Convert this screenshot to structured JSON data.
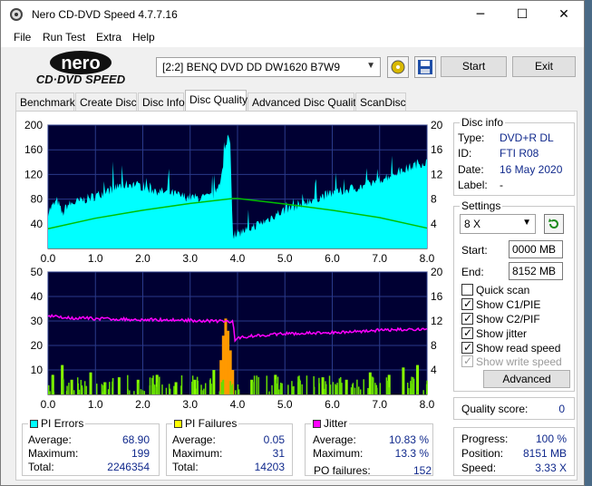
{
  "window": {
    "title": "Nero CD-DVD Speed 4.7.7.16"
  },
  "menu": [
    "File",
    "Run Test",
    "Extra",
    "Help"
  ],
  "logo": {
    "line1": "nero",
    "line2": "CD·DVD SPEED"
  },
  "toolbar": {
    "drive": "[2:2]   BENQ DVD DD DW1620 B7W9",
    "start_label": "Start",
    "exit_label": "Exit"
  },
  "tabs": [
    "Benchmark",
    "Create Disc",
    "Disc Info",
    "Disc Quality",
    "Advanced Disc Quality",
    "ScanDisc"
  ],
  "active_tab": "Disc Quality",
  "disc_info": {
    "title": "Disc info",
    "type_label": "Type:",
    "type": "DVD+R DL",
    "id_label": "ID:",
    "id": "FTI R08",
    "date_label": "Date:",
    "date": "16 May 2020",
    "label_label": "Label:",
    "label": "-"
  },
  "settings": {
    "title": "Settings",
    "speed": "8 X",
    "start_label": "Start:",
    "start": "0000 MB",
    "end_label": "End:",
    "end": "8152 MB",
    "quick_scan": "Quick scan",
    "show_c1pie": "Show C1/PIE",
    "show_c2pif": "Show C2/PIF",
    "show_jitter": "Show jitter",
    "show_read_speed": "Show read speed",
    "show_write_speed": "Show write speed",
    "advanced_label": "Advanced"
  },
  "quality": {
    "label": "Quality score:",
    "value": "0"
  },
  "progress": {
    "progress_label": "Progress:",
    "progress": "100 %",
    "position_label": "Position:",
    "position": "8151 MB",
    "speed_label": "Speed:",
    "speed": "3.33 X"
  },
  "pi_errors": {
    "title": "PI Errors",
    "avg_label": "Average:",
    "avg": "68.90",
    "max_label": "Maximum:",
    "max": "199",
    "total_label": "Total:",
    "total": "2246354",
    "color": "#00ffff"
  },
  "pi_failures": {
    "title": "PI Failures",
    "avg_label": "Average:",
    "avg": "0.05",
    "max_label": "Maximum:",
    "max": "31",
    "total_label": "Total:",
    "total": "14203",
    "color": "#ffff00"
  },
  "jitter": {
    "title": "Jitter",
    "avg_label": "Average:",
    "avg": "10.83 %",
    "max_label": "Maximum:",
    "max": "13.3 %",
    "pof_label": "PO failures:",
    "pof": "152",
    "color": "#ff00ff"
  },
  "chart_data": [
    {
      "type": "area",
      "x_ticks": [
        "0.0",
        "1.0",
        "2.0",
        "3.0",
        "4.0",
        "5.0",
        "6.0",
        "7.0",
        "8.0"
      ],
      "y_left_ticks": [
        "200",
        "160",
        "120",
        "80",
        "40"
      ],
      "y_right_ticks": [
        "20",
        "16",
        "12",
        "8",
        "4"
      ],
      "xlim": [
        0,
        8
      ],
      "ylim": [
        0,
        200
      ],
      "y2lim": [
        0,
        20
      ],
      "series": [
        {
          "name": "PI Errors",
          "color": "#00ffff",
          "x": [
            0.0,
            0.2,
            0.3,
            0.4,
            0.6,
            0.8,
            1.0,
            1.2,
            1.4,
            1.6,
            1.8,
            2.0,
            2.2,
            2.4,
            2.6,
            2.8,
            3.0,
            3.2,
            3.4,
            3.5,
            3.6,
            3.7,
            3.75,
            3.8,
            3.85,
            3.9,
            3.95,
            4.0,
            4.2,
            4.4,
            4.6,
            4.8,
            5.0,
            5.2,
            5.4,
            5.6,
            5.8,
            6.0,
            6.2,
            6.4,
            6.6,
            6.8,
            7.0,
            7.2,
            7.4,
            7.6,
            7.8,
            8.0
          ],
          "y": [
            60,
            78,
            55,
            70,
            75,
            80,
            85,
            92,
            98,
            103,
            105,
            100,
            95,
            92,
            90,
            85,
            83,
            82,
            83,
            88,
            105,
            130,
            165,
            185,
            175,
            20,
            25,
            25,
            30,
            38,
            45,
            55,
            62,
            68,
            75,
            80,
            85,
            90,
            93,
            97,
            100,
            105,
            112,
            118,
            125,
            130,
            138,
            140
          ]
        },
        {
          "name": "Read speed",
          "color": "#00a000",
          "x": [
            0.0,
            1.0,
            2.0,
            3.0,
            3.9,
            4.0,
            5.0,
            6.0,
            7.0,
            8.0
          ],
          "y": [
            3.2,
            4.9,
            6.2,
            7.3,
            8.1,
            8.1,
            7.2,
            6.2,
            5.0,
            3.3
          ]
        }
      ]
    },
    {
      "type": "bar",
      "x_ticks": [
        "0.0",
        "1.0",
        "2.0",
        "3.0",
        "4.0",
        "5.0",
        "6.0",
        "7.0",
        "8.0"
      ],
      "y_left_ticks": [
        "50",
        "40",
        "30",
        "20",
        "10"
      ],
      "y_right_ticks": [
        "20",
        "16",
        "12",
        "8",
        "4"
      ],
      "xlim": [
        0,
        8
      ],
      "ylim": [
        0,
        50
      ],
      "y2lim": [
        0,
        20
      ],
      "series": [
        {
          "name": "PI Failures",
          "color": "#ffff00",
          "x": [
            0.1,
            0.3,
            0.5,
            0.9,
            1.2,
            1.5,
            1.9,
            2.3,
            2.7,
            3.1,
            3.5,
            3.65,
            3.7,
            3.75,
            3.8,
            3.85,
            3.9,
            4.3,
            4.8,
            5.3,
            5.8,
            6.3,
            6.8,
            7.2,
            7.5,
            7.8
          ],
          "y": [
            8,
            12,
            6,
            9,
            5,
            7,
            6,
            8,
            5,
            6,
            10,
            14,
            24,
            31,
            26,
            18,
            10,
            6,
            8,
            5,
            7,
            6,
            9,
            8,
            11,
            12
          ]
        },
        {
          "name": "Jitter",
          "color": "#ff00ff",
          "x": [
            0.0,
            0.5,
            1.0,
            1.5,
            2.0,
            2.5,
            3.0,
            3.5,
            3.9,
            3.95,
            4.0,
            4.5,
            5.0,
            5.5,
            6.0,
            6.5,
            7.0,
            7.5,
            8.0
          ],
          "y": [
            12.8,
            12.5,
            12.4,
            12.3,
            12.2,
            12.2,
            12.1,
            12.0,
            11.9,
            8.6,
            9.3,
            9.7,
            9.9,
            10.0,
            10.1,
            10.3,
            10.5,
            10.6,
            10.7
          ]
        }
      ]
    }
  ]
}
